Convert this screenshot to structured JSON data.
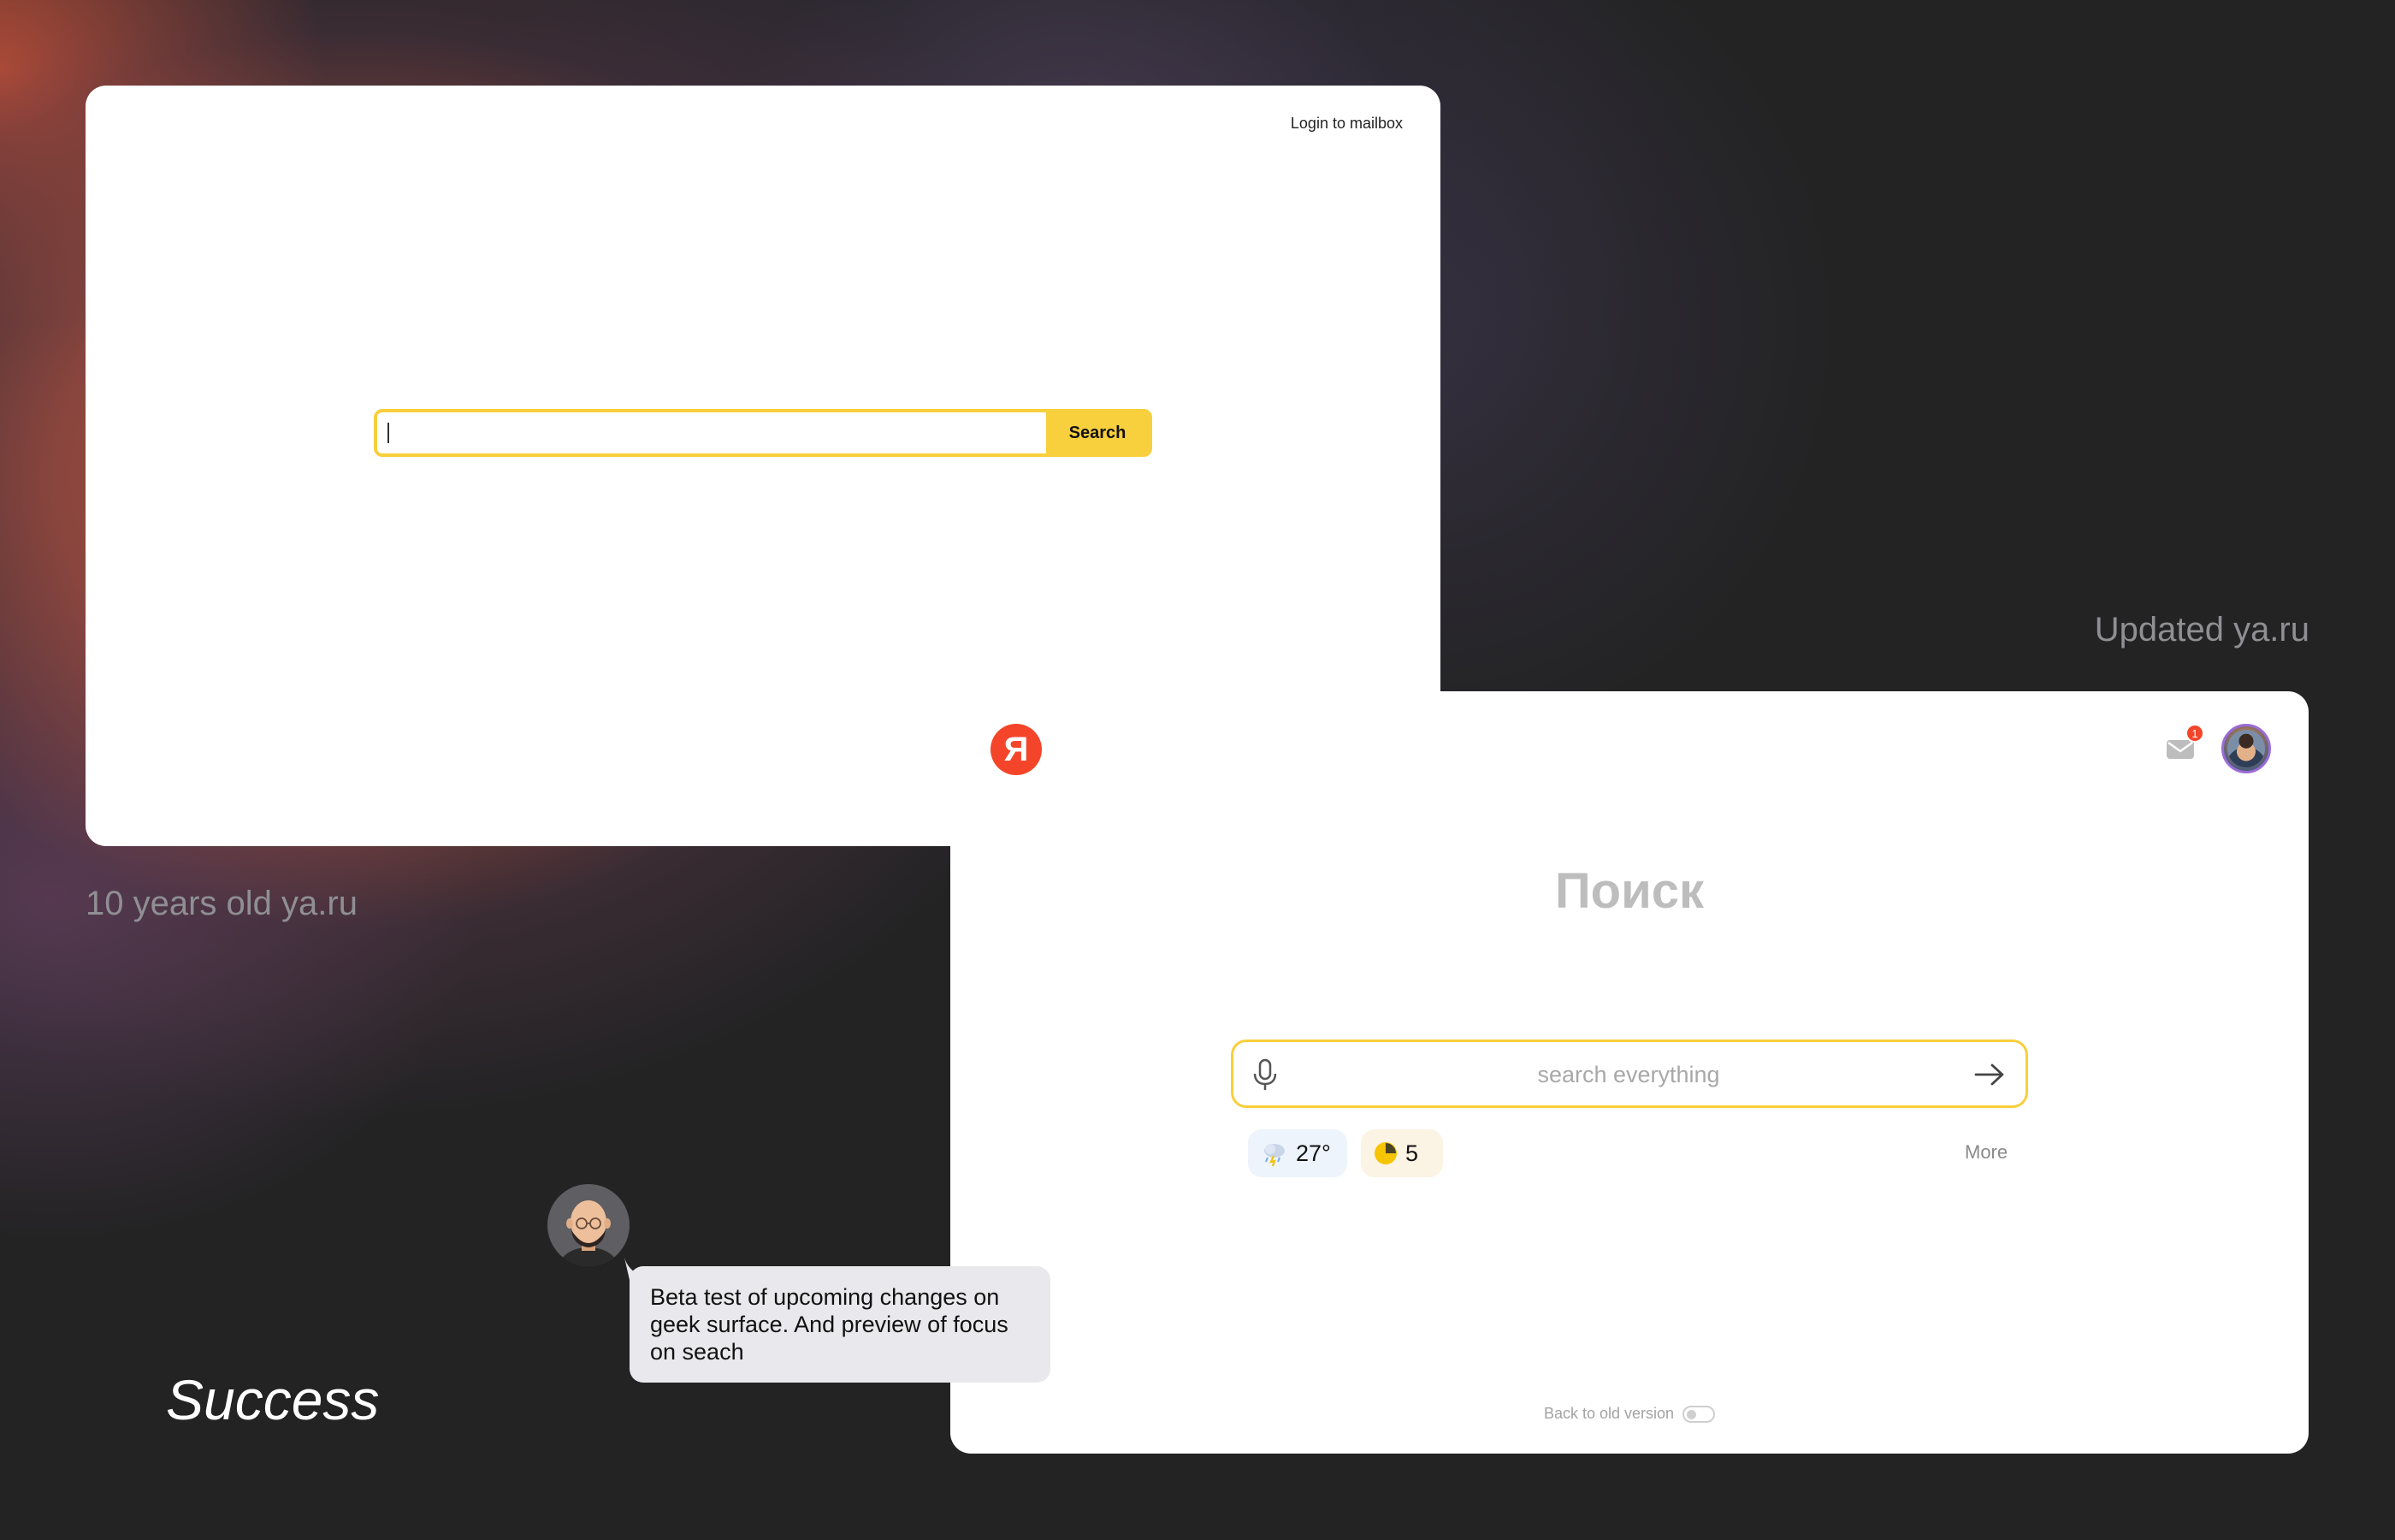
{
  "old_site": {
    "login_link": "Login to mailbox",
    "search_button": "Search",
    "caption": "10 years old ya.ru"
  },
  "new_site": {
    "caption": "Updated ya.ru",
    "logo_letter": "Я",
    "mail_badge": "1",
    "title": "Поиск",
    "search_placeholder": "search everything",
    "weather": "27°",
    "traffic": "5",
    "more": "More",
    "back_to_old": "Back to old version"
  },
  "comment": {
    "text": "Beta test of upcoming changes on geek surface. And preview of focus on seach"
  },
  "status": "Success",
  "colors": {
    "accent_yellow": "#f8cf3c",
    "logo_red": "#f4452a",
    "background": "#232324"
  },
  "icons": [
    "mail-icon",
    "mic-icon",
    "arrow-right-icon",
    "weather-icon",
    "traffic-icon"
  ]
}
